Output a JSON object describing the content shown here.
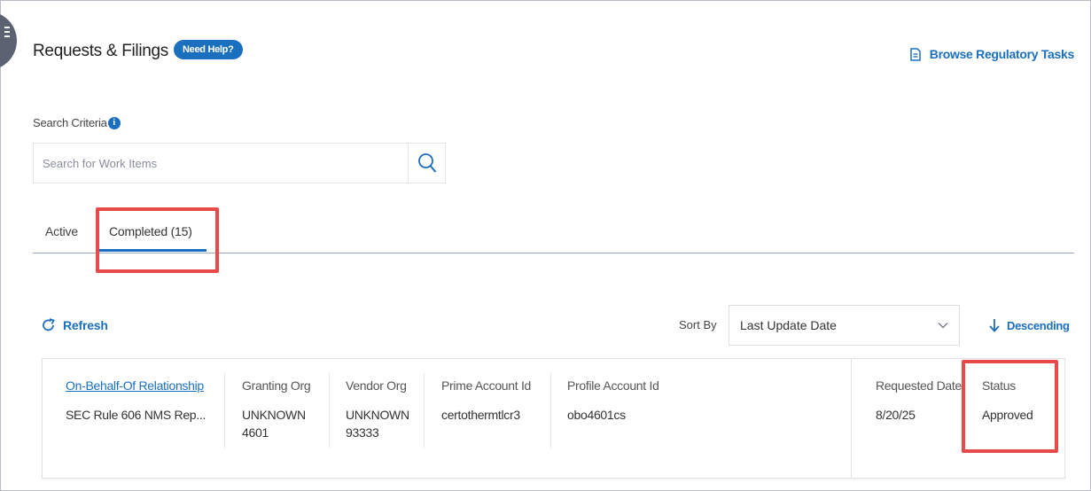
{
  "header": {
    "title": "Requests & Filings",
    "help_label": "Need Help?",
    "browse_label": "Browse Regulatory Tasks"
  },
  "search": {
    "label": "Search Criteria",
    "placeholder": "Search for Work Items",
    "value": ""
  },
  "tabs": [
    {
      "label": "Active"
    },
    {
      "label": "Completed (15)",
      "selected": true
    }
  ],
  "toolbar": {
    "refresh_label": "Refresh",
    "sort_by_label": "Sort By",
    "sort_value": "Last Update Date",
    "order_label": "Descending"
  },
  "results": [
    {
      "type": "On-Behalf-Of Relationship",
      "description": "SEC Rule 606 NMS Rep...",
      "granting_org_header": "Granting Org",
      "granting_org_line1": "UNKNOWN",
      "granting_org_line2": "4601",
      "vendor_org_header": "Vendor Org",
      "vendor_org_line1": "UNKNOWN",
      "vendor_org_line2": "93333",
      "prime_account_header": "Prime Account Id",
      "prime_account_id": "certothermtlcr3",
      "profile_account_header": "Profile Account Id",
      "profile_account_id": "obo4601cs",
      "requested_date_header": "Requested Date",
      "requested_date": "8/20/25",
      "status_header": "Status",
      "status": "Approved"
    }
  ],
  "colors": {
    "accent": "#1b6fbf",
    "highlight": "#e84a4a",
    "side_tab": "#5b6373"
  },
  "icons": {
    "menu": "menu-icon",
    "document": "document-icon",
    "info": "info-icon",
    "search": "search-icon",
    "refresh": "refresh-icon",
    "chevron": "chevron-down-icon",
    "arrow": "arrow-down-icon"
  }
}
